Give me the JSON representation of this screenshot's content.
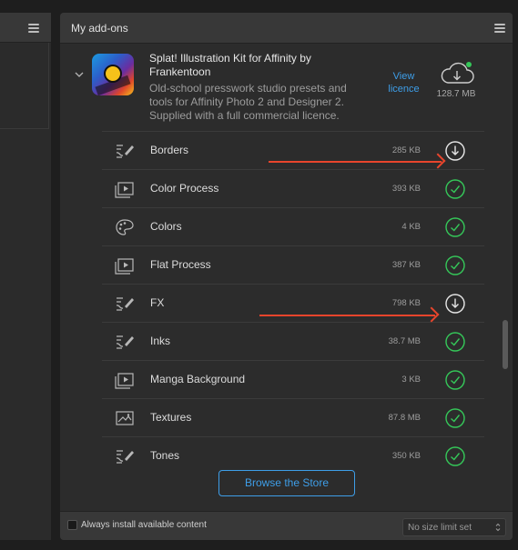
{
  "panel": {
    "title": "My add-ons"
  },
  "addon": {
    "title": "Splat! Illustration Kit for Affinity by Frankentoon",
    "description": "Old-school presswork studio presets and tools for Affinity Photo 2 and Designer 2. Supplied with a full commercial licence.",
    "view_licence_label": "View licence",
    "total_size": "128.7 MB",
    "items": [
      {
        "name": "Borders",
        "size": "285 KB",
        "icon": "brush-stroke-icon",
        "status": "download"
      },
      {
        "name": "Color Process",
        "size": "393 KB",
        "icon": "macro-play-icon",
        "status": "installed"
      },
      {
        "name": "Colors",
        "size": "4 KB",
        "icon": "palette-icon",
        "status": "installed"
      },
      {
        "name": "Flat Process",
        "size": "387 KB",
        "icon": "macro-play-icon",
        "status": "installed"
      },
      {
        "name": "FX",
        "size": "798 KB",
        "icon": "brush-stroke-icon",
        "status": "download"
      },
      {
        "name": "Inks",
        "size": "38.7 MB",
        "icon": "brush-stroke-icon",
        "status": "installed"
      },
      {
        "name": "Manga Background",
        "size": "3 KB",
        "icon": "macro-play-icon",
        "status": "installed"
      },
      {
        "name": "Textures",
        "size": "87.8 MB",
        "icon": "image-icon",
        "status": "installed"
      },
      {
        "name": "Tones",
        "size": "350 KB",
        "icon": "brush-stroke-icon",
        "status": "installed"
      }
    ]
  },
  "browse_store_label": "Browse the Store",
  "footer": {
    "always_install_label": "Always install available content",
    "size_limit_value": "No size limit set"
  },
  "colors": {
    "accent": "#3e9ee8",
    "installed": "#35c759",
    "annotation_arrow": "#e8452c"
  }
}
